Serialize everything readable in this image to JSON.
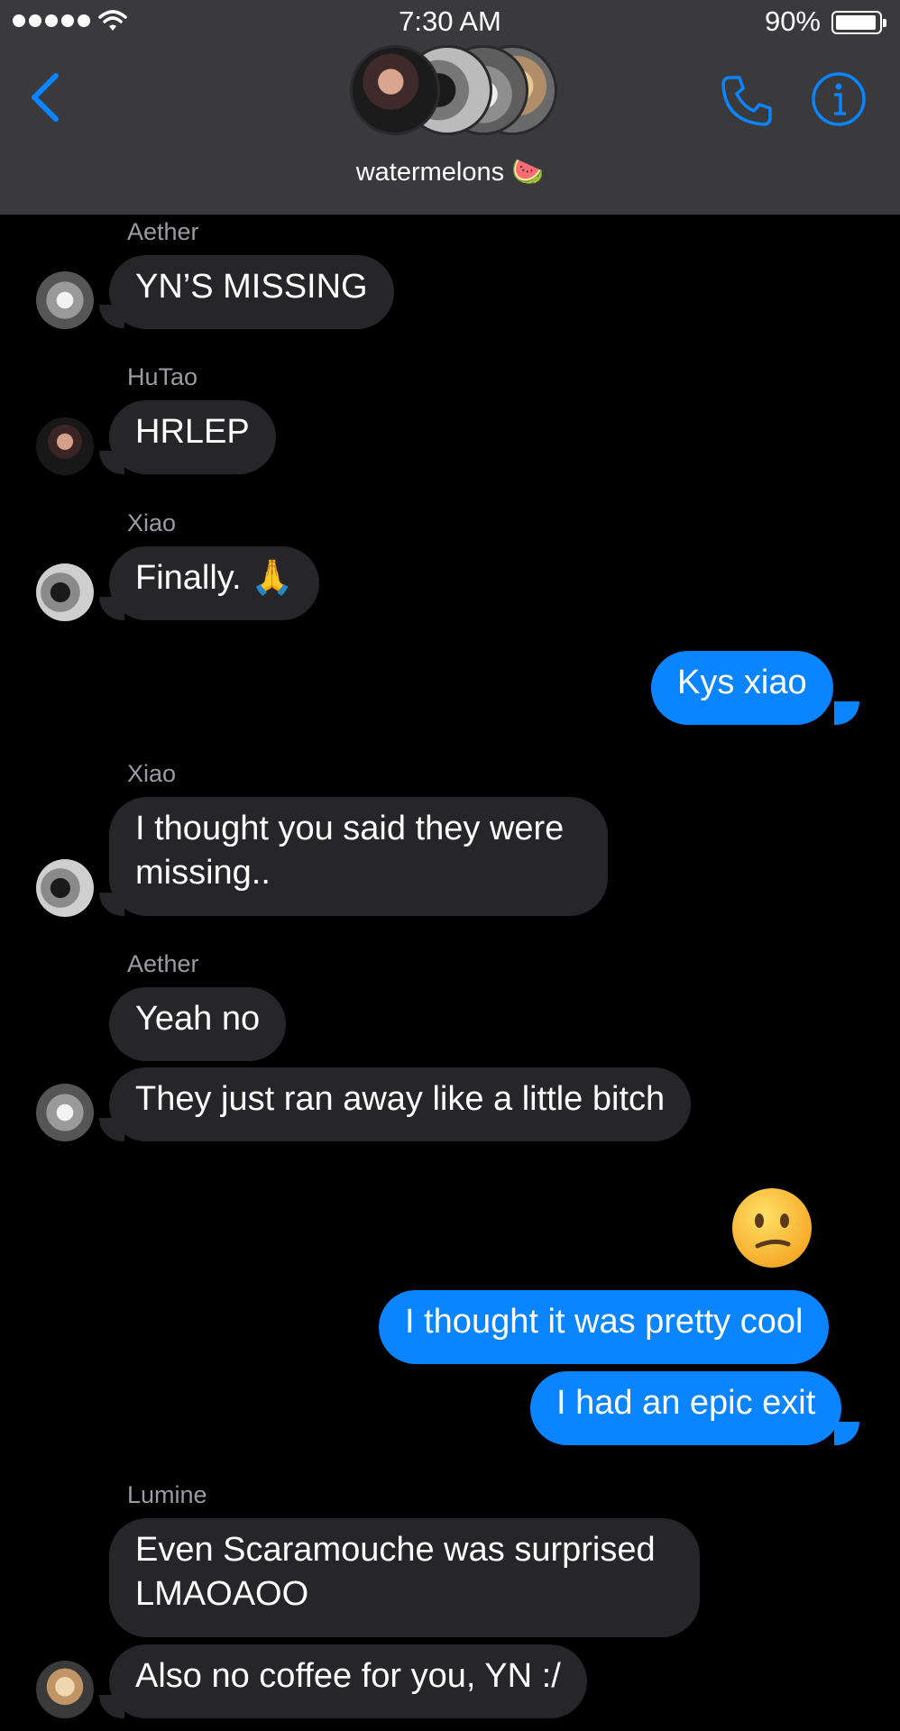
{
  "status_bar": {
    "time": "7:30 AM",
    "battery": "90%",
    "signal_bars": 5
  },
  "header": {
    "title": "watermelons 🍉",
    "back_icon": "chevron-left-icon",
    "call_icon": "phone-icon",
    "info_icon": "info-icon",
    "accent_color": "#0a84ff"
  },
  "messages": [
    {
      "sender": "Aether",
      "text": "YN’S MISSING",
      "direction": "in"
    },
    {
      "sender": "HuTao",
      "text": "HRLEP",
      "direction": "in"
    },
    {
      "sender": "Xiao",
      "text": "Finally. 🙏",
      "direction": "in"
    },
    {
      "text": "Kys xiao",
      "direction": "out"
    },
    {
      "sender": "Xiao",
      "text": "I thought you said they were missing..",
      "direction": "in"
    },
    {
      "sender": "Aether",
      "text": "Yeah no",
      "direction": "in"
    },
    {
      "text": "They just ran away like a little bitch",
      "direction": "in"
    },
    {
      "text": "😕",
      "direction": "out",
      "type": "emoji"
    },
    {
      "text": "I thought it was pretty cool",
      "direction": "out"
    },
    {
      "text": "I had an epic exit",
      "direction": "out"
    },
    {
      "sender": "Lumine",
      "text": "Even Scaramouche was surprised LMAOAOO",
      "direction": "in"
    },
    {
      "text": "Also no coffee for you, YN :/",
      "direction": "in"
    }
  ]
}
